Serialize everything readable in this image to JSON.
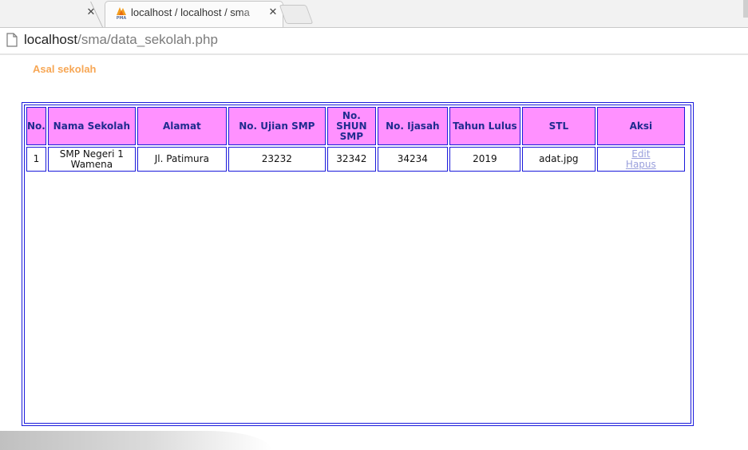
{
  "browser": {
    "tab": {
      "title": "localhost / localhost / sma",
      "favicon": "phpmyadmin-icon",
      "close_glyph": "✕"
    },
    "prev_tab_close_glyph": "✕",
    "address": {
      "host": "localhost",
      "path": "/sma/data_sekolah.php"
    }
  },
  "page": {
    "heading": "Asal sekolah",
    "table": {
      "headers": [
        "No.",
        "Nama Sekolah",
        "Alamat",
        "No. Ujian SMP",
        "No. SHUN SMP",
        "No. Ijasah",
        "Tahun Lulus",
        "STL",
        "Aksi"
      ],
      "rows": [
        {
          "no": "1",
          "nama_sekolah": "SMP Negeri 1 Wamena",
          "alamat": "Jl. Patimura",
          "no_ujian_smp": "23232",
          "no_shun_smp": "32342",
          "no_ijasah": "34234",
          "tahun_lulus": "2019",
          "stl": "adat.jpg",
          "aksi": {
            "edit": "Edit",
            "hapus": "Hapus"
          }
        }
      ]
    }
  },
  "colors": {
    "header_bg": "#ff91ff",
    "border": "#1a1adb",
    "heading": "#f7a755",
    "link": "#9aa0dc"
  }
}
